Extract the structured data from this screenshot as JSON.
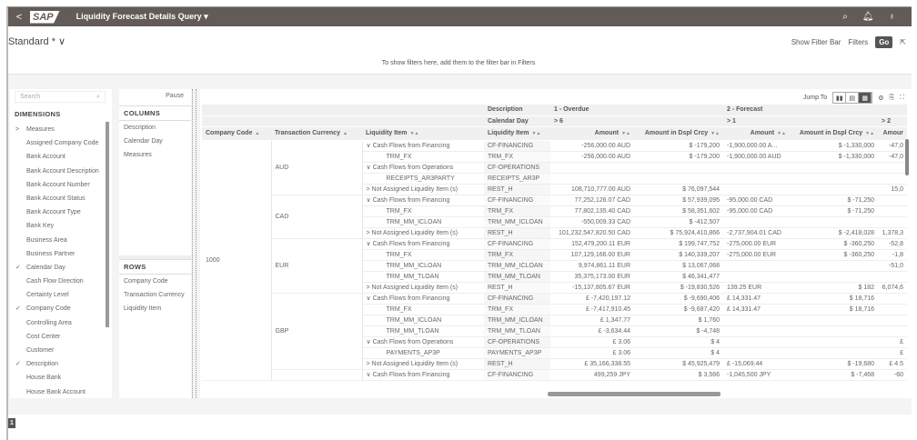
{
  "shell": {
    "back": "<",
    "logo": "SAP",
    "title": "Liquidity Forecast Details Query ▾",
    "icons": [
      "search-icon",
      "bell-icon",
      "user-icon"
    ]
  },
  "variant": {
    "label": "Standard *",
    "chevron": "∨"
  },
  "filterbar": {
    "show": "Show Filter Bar",
    "filters": "Filters",
    "go": "Go",
    "share": "⇱",
    "message": "To show filters here, add them to the filter bar in Filters"
  },
  "dimensions": {
    "search_placeholder": "Search",
    "header": "DIMENSIONS",
    "items": [
      {
        "label": "Measures",
        "mark": ">"
      },
      {
        "label": "Assigned Company Code",
        "mark": ""
      },
      {
        "label": "Bank Account",
        "mark": ""
      },
      {
        "label": "Bank Account Description",
        "mark": ""
      },
      {
        "label": "Bank Account Number",
        "mark": ""
      },
      {
        "label": "Bank Account Status",
        "mark": ""
      },
      {
        "label": "Bank Account Type",
        "mark": ""
      },
      {
        "label": "Bank Key",
        "mark": ""
      },
      {
        "label": "Business Area",
        "mark": ""
      },
      {
        "label": "Business Partner",
        "mark": ""
      },
      {
        "label": "Calendar Day",
        "mark": "✓"
      },
      {
        "label": "Cash Flow Direction",
        "mark": ""
      },
      {
        "label": "Certainty Level",
        "mark": ""
      },
      {
        "label": "Company Code",
        "mark": "✓"
      },
      {
        "label": "Controlling Area",
        "mark": ""
      },
      {
        "label": "Cost Center",
        "mark": ""
      },
      {
        "label": "Customer",
        "mark": ""
      },
      {
        "label": "Description",
        "mark": "✓"
      },
      {
        "label": "House Bank",
        "mark": ""
      },
      {
        "label": "House Bank Account",
        "mark": ""
      }
    ]
  },
  "layout": {
    "pause": "Pause",
    "columns_header": "COLUMNS",
    "columns": [
      "Description",
      "Calendar Day",
      "Measures"
    ],
    "rows_header": "ROWS",
    "rows": [
      "Company Code",
      "Transaction Currency",
      "Liquidity Item"
    ]
  },
  "toolbar": {
    "jump_to": "Jump To"
  },
  "table": {
    "desc_label": "Description",
    "day_label": "Calendar Day",
    "groups": [
      {
        "desc": "1 - Overdue",
        "day": "> 6"
      },
      {
        "desc": "2 - Forecast",
        "day": "> 1"
      },
      {
        "desc": "",
        "day": "> 2"
      }
    ],
    "headers": [
      "Company Code",
      "Transaction Currency",
      "Liquidity Item",
      "Liquidity Item",
      "Amount",
      "Amount in Dspl Crcy",
      "Amount",
      "Amount in Dspl Crcy",
      "Amour"
    ],
    "company": "1000",
    "currencies": [
      {
        "code": "AUD",
        "rows": 5
      },
      {
        "code": "CAD",
        "rows": 4
      },
      {
        "code": "EUR",
        "rows": 5
      },
      {
        "code": "GBP",
        "rows": 7
      },
      {
        "code": "",
        "rows": 1
      }
    ],
    "rows": [
      {
        "item": "∨ Cash Flows from Financing",
        "key": "CF-FINANCING",
        "a1": "-256,000.00 AUD",
        "d1": "$ -179,200",
        "a2": "-1,900,000.00 A...",
        "d2": "$ -1,330,000",
        "a3": "-47,0"
      },
      {
        "item": "TRM_FX",
        "child": true,
        "key": "TRM_FX",
        "a1": "-256,000.00 AUD",
        "d1": "$ -179,200",
        "a2": "-1,900,000.00 AUD",
        "d2": "$ -1,330,000",
        "a3": "-47,0"
      },
      {
        "item": "∨ Cash Flows from Operations",
        "key": "CF-OPERATIONS",
        "a1": "",
        "d1": "",
        "a2": "",
        "d2": "",
        "a3": ""
      },
      {
        "item": "RECEIPTS_AR3PARTY",
        "child": true,
        "key": "RECEIPTS_AR3P",
        "a1": "",
        "d1": "",
        "a2": "",
        "d2": "",
        "a3": ""
      },
      {
        "item": "> Not Assigned Liquidity Item (s)",
        "key": "REST_H",
        "a1": "108,710,777.00 AUD",
        "d1": "$ 76,097,544",
        "a2": "",
        "d2": "",
        "a3": "15,0"
      },
      {
        "item": "∨ Cash Flows from Financing",
        "key": "CF-FINANCING",
        "a1": "77,252,126.07 CAD",
        "d1": "$ 57,939,095",
        "a2": "-95,000.00 CAD",
        "d2": "$ -71,250",
        "a3": ""
      },
      {
        "item": "TRM_FX",
        "child": true,
        "key": "TRM_FX",
        "a1": "77,802,135.40 CAD",
        "d1": "$ 58,351,602",
        "a2": "-95,000.00 CAD",
        "d2": "$ -71,250",
        "a3": ""
      },
      {
        "item": "TRM_MM_ICLOAN",
        "child": true,
        "key": "TRM_MM_ICLOAN",
        "a1": "-550,009.33 CAD",
        "d1": "$ -412,507",
        "a2": "",
        "d2": "",
        "a3": ""
      },
      {
        "item": "> Not Assigned Liquidity Item (s)",
        "key": "REST_H",
        "a1": "101,232,547,820.50 CAD",
        "d1": "$ 75,924,410,866",
        "a2": "-2,737,904.01 CAD",
        "d2": "$ -2,418,028",
        "a3": "1,378,3"
      },
      {
        "item": "∨ Cash Flows from Financing",
        "key": "CF-FINANCING",
        "a1": "152,479,200.11 EUR",
        "d1": "$ 199,747,752",
        "a2": "-275,000.00 EUR",
        "d2": "$ -360,250",
        "a3": "-52,8"
      },
      {
        "item": "TRM_FX",
        "child": true,
        "key": "TRM_FX",
        "a1": "107,129,166.00 EUR",
        "d1": "$ 140,339,207",
        "a2": "-275,000.00 EUR",
        "d2": "$ -360,250",
        "a3": "-1,8"
      },
      {
        "item": "TRM_MM_ICLOAN",
        "child": true,
        "key": "TRM_MM_ICLOAN",
        "a1": "9,974,861.11 EUR",
        "d1": "$ 13,067,068",
        "a2": "",
        "d2": "",
        "a3": "-51,0"
      },
      {
        "item": "TRM_MM_TLOAN",
        "child": true,
        "key": "TRM_MM_TLOAN",
        "a1": "35,375,173.00 EUR",
        "d1": "$ 46,341,477",
        "a2": "",
        "d2": "",
        "a3": ""
      },
      {
        "item": "> Not Assigned Liquidity Item (s)",
        "key": "REST_H",
        "a1": "-15,137,805.67 EUR",
        "d1": "$ -19,830,526",
        "a2": "139.25 EUR",
        "d2": "$ 182",
        "a3": "6,074,6"
      },
      {
        "item": "∨ Cash Flows from Financing",
        "key": "CF-FINANCING",
        "a1": "£ -7,420,197.12",
        "d1": "$ -9,690,406",
        "a2": "£ 14,331.47",
        "d2": "$ 18,716",
        "a3": ""
      },
      {
        "item": "TRM_FX",
        "child": true,
        "key": "TRM_FX",
        "a1": "£ -7,417,910.45",
        "d1": "$ -9,687,420",
        "a2": "£ 14,331.47",
        "d2": "$ 18,716",
        "a3": ""
      },
      {
        "item": "TRM_MM_ICLOAN",
        "child": true,
        "key": "TRM_MM_ICLOAN",
        "a1": "£ 1,347.77",
        "d1": "$ 1,760",
        "a2": "",
        "d2": "",
        "a3": ""
      },
      {
        "item": "TRM_MM_TLOAN",
        "child": true,
        "key": "TRM_MM_TLOAN",
        "a1": "£ -3,634.44",
        "d1": "$ -4,748",
        "a2": "",
        "d2": "",
        "a3": ""
      },
      {
        "item": "∨ Cash Flows from Operations",
        "key": "CF-OPERATIONS",
        "a1": "£ 3.06",
        "d1": "$ 4",
        "a2": "",
        "d2": "",
        "a3": "£"
      },
      {
        "item": "PAYMENTS_AP3P",
        "child": true,
        "key": "PAYMENTS_AP3P",
        "a1": "£ 3.06",
        "d1": "$ 4",
        "a2": "",
        "d2": "",
        "a3": "£"
      },
      {
        "item": "> Not Assigned Liquidity Item (s)",
        "key": "REST_H",
        "a1": "£ 35,166,338.55",
        "d1": "$ 45,925,479",
        "a2": "£ -15,069.44",
        "d2": "$ -19,680",
        "a3": "£ 4.5"
      },
      {
        "item": "∨ Cash Flows from Financing",
        "key": "CF-FINANCING",
        "a1": "499,259 JPY",
        "d1": "$ 3,566",
        "a2": "-1,045,500 JPY",
        "d2": "$ -7,468",
        "a3": "-60"
      }
    ]
  },
  "footer": {
    "page": "1"
  },
  "colors": {
    "shell": "#625b57",
    "go": "#555555"
  }
}
